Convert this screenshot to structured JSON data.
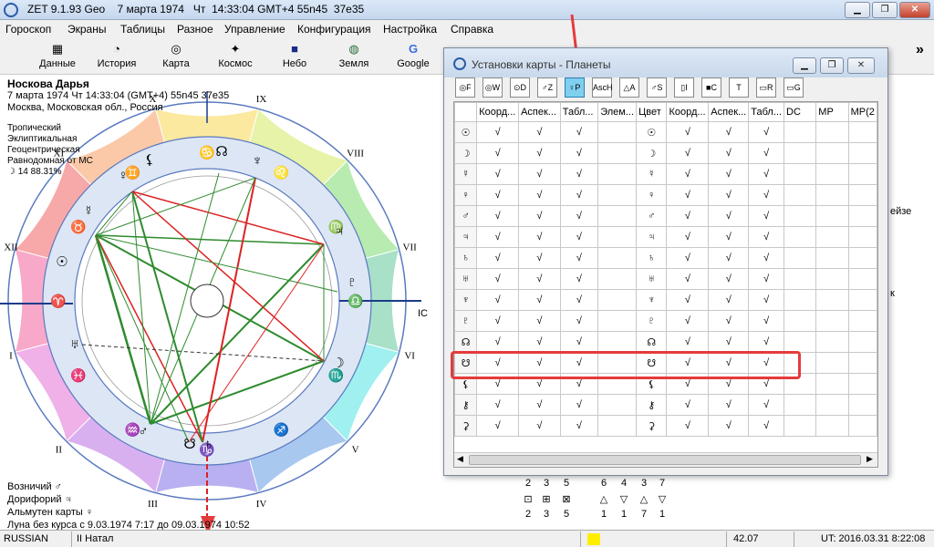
{
  "window": {
    "title": "ZET 9.1.93 Geo    7 марта 1974   Чт  14:33:04 GMT+4 55n45  37e35",
    "min": "▁",
    "max": "❐",
    "close": "✕"
  },
  "menu": [
    "Гороскоп",
    "Экраны",
    "Таблицы",
    "Разное",
    "Управление",
    "Конфигурация",
    "Настройка",
    "Справка"
  ],
  "toolbar": [
    {
      "label": "Данные",
      "icon": "▦"
    },
    {
      "label": "История",
      "icon": "◔"
    },
    {
      "label": "Карта",
      "icon": "◎"
    },
    {
      "label": "Космос",
      "icon": "✦"
    },
    {
      "label": "Небо",
      "icon": "■"
    },
    {
      "label": "Земля",
      "icon": "◍"
    },
    {
      "label": "Google",
      "icon": "G"
    }
  ],
  "toolbar_more": "»",
  "person": {
    "name": "Носкова Дарья",
    "datetime": "7 марта 1974   Чт   14:33:04 (GMT+4) 55n45   37e35",
    "place": "Москва, Московская обл., Россия"
  },
  "chart_settings": [
    "Тропический",
    "Эклиптикальная",
    "Геоцентрическая",
    "Равнодомная от МС"
  ],
  "moon_line": "☽   14 88.31%",
  "houses": [
    "I",
    "II",
    "III",
    "IV",
    "V",
    "VI",
    "VII",
    "VIII",
    "IX",
    "X",
    "XI",
    "XII"
  ],
  "cusps": {
    "ic": "IC"
  },
  "signs": [
    "♈",
    "♉",
    "♊",
    "♋",
    "♌",
    "♍",
    "♎",
    "♏",
    "♐",
    "♑",
    "♒",
    "♓"
  ],
  "planets": [
    "☉",
    "☽",
    "☿",
    "♀",
    "♂",
    "♃",
    "♄",
    "♅",
    "♆",
    "♇",
    "☊",
    "☋",
    "⚸"
  ],
  "retro": "R",
  "bottom_info": [
    "Возничий  ♂",
    "Дорифорий  ♃",
    "Альмутен карты  ♀",
    "Луна без курса с 9.03.1974   7:17 до 09.03.1974 10:52"
  ],
  "stats": {
    "top": [
      "2",
      "3",
      "5",
      "6",
      "4",
      "3",
      "7"
    ],
    "icons": [
      "⊡",
      "⊞",
      "⊠",
      "△",
      "▽",
      "△",
      "▽"
    ],
    "bottom": [
      "2",
      "3",
      "5",
      "1",
      "1",
      "7",
      "1"
    ]
  },
  "partial_right": [
    "ейзе",
    "к"
  ],
  "status": {
    "lang": "RUSSIAN",
    "mode": "II Натал",
    "value": "42.07",
    "ut": "UT: 2016.03.31   8:22:08",
    "indicator_color": "#ffee00"
  },
  "dialog": {
    "title": "Установки карты - Планеты",
    "icons": [
      "F",
      "W",
      "D",
      "Z",
      "P",
      "H",
      "A",
      "S",
      "I",
      "C",
      "T",
      "R",
      "G"
    ],
    "icons_full": [
      "◎F",
      "◎W",
      "⊙D",
      "♂Z",
      "♀P",
      "AscH",
      "△A",
      "♂S",
      "▯I",
      "■C",
      "T",
      "▭R",
      "▭G"
    ],
    "active_icon": 4,
    "columns": [
      "",
      "Коорд...",
      "Аспек...",
      "Табл...",
      "Элем...",
      "Цвет",
      "Коорд...",
      "Аспек...",
      "Табл...",
      "DC",
      "MP",
      "MP(2"
    ],
    "check": "√",
    "rows": [
      {
        "glyph": "☉",
        "elem": ""
      },
      {
        "glyph": "☽",
        "elem": ""
      },
      {
        "glyph": "☿",
        "elem": ""
      },
      {
        "glyph": "♀",
        "elem": ""
      },
      {
        "glyph": "♂",
        "elem": ""
      },
      {
        "glyph": "♃",
        "elem": ""
      },
      {
        "glyph": "♄",
        "elem": ""
      },
      {
        "glyph": "♅",
        "elem": ""
      },
      {
        "glyph": "♆",
        "elem": ""
      },
      {
        "glyph": "♇",
        "elem": ""
      },
      {
        "glyph": "☊",
        "elem": ""
      },
      {
        "glyph": "☋",
        "elem": ""
      },
      {
        "glyph": "⚸",
        "elem": ""
      },
      {
        "glyph": "⚷",
        "elem": ""
      },
      {
        "glyph": "⚳",
        "elem": ""
      }
    ]
  },
  "colors": {
    "accent_red": "#e53b3b",
    "aspect_green": "#2e8b2e",
    "aspect_red": "#d22"
  }
}
